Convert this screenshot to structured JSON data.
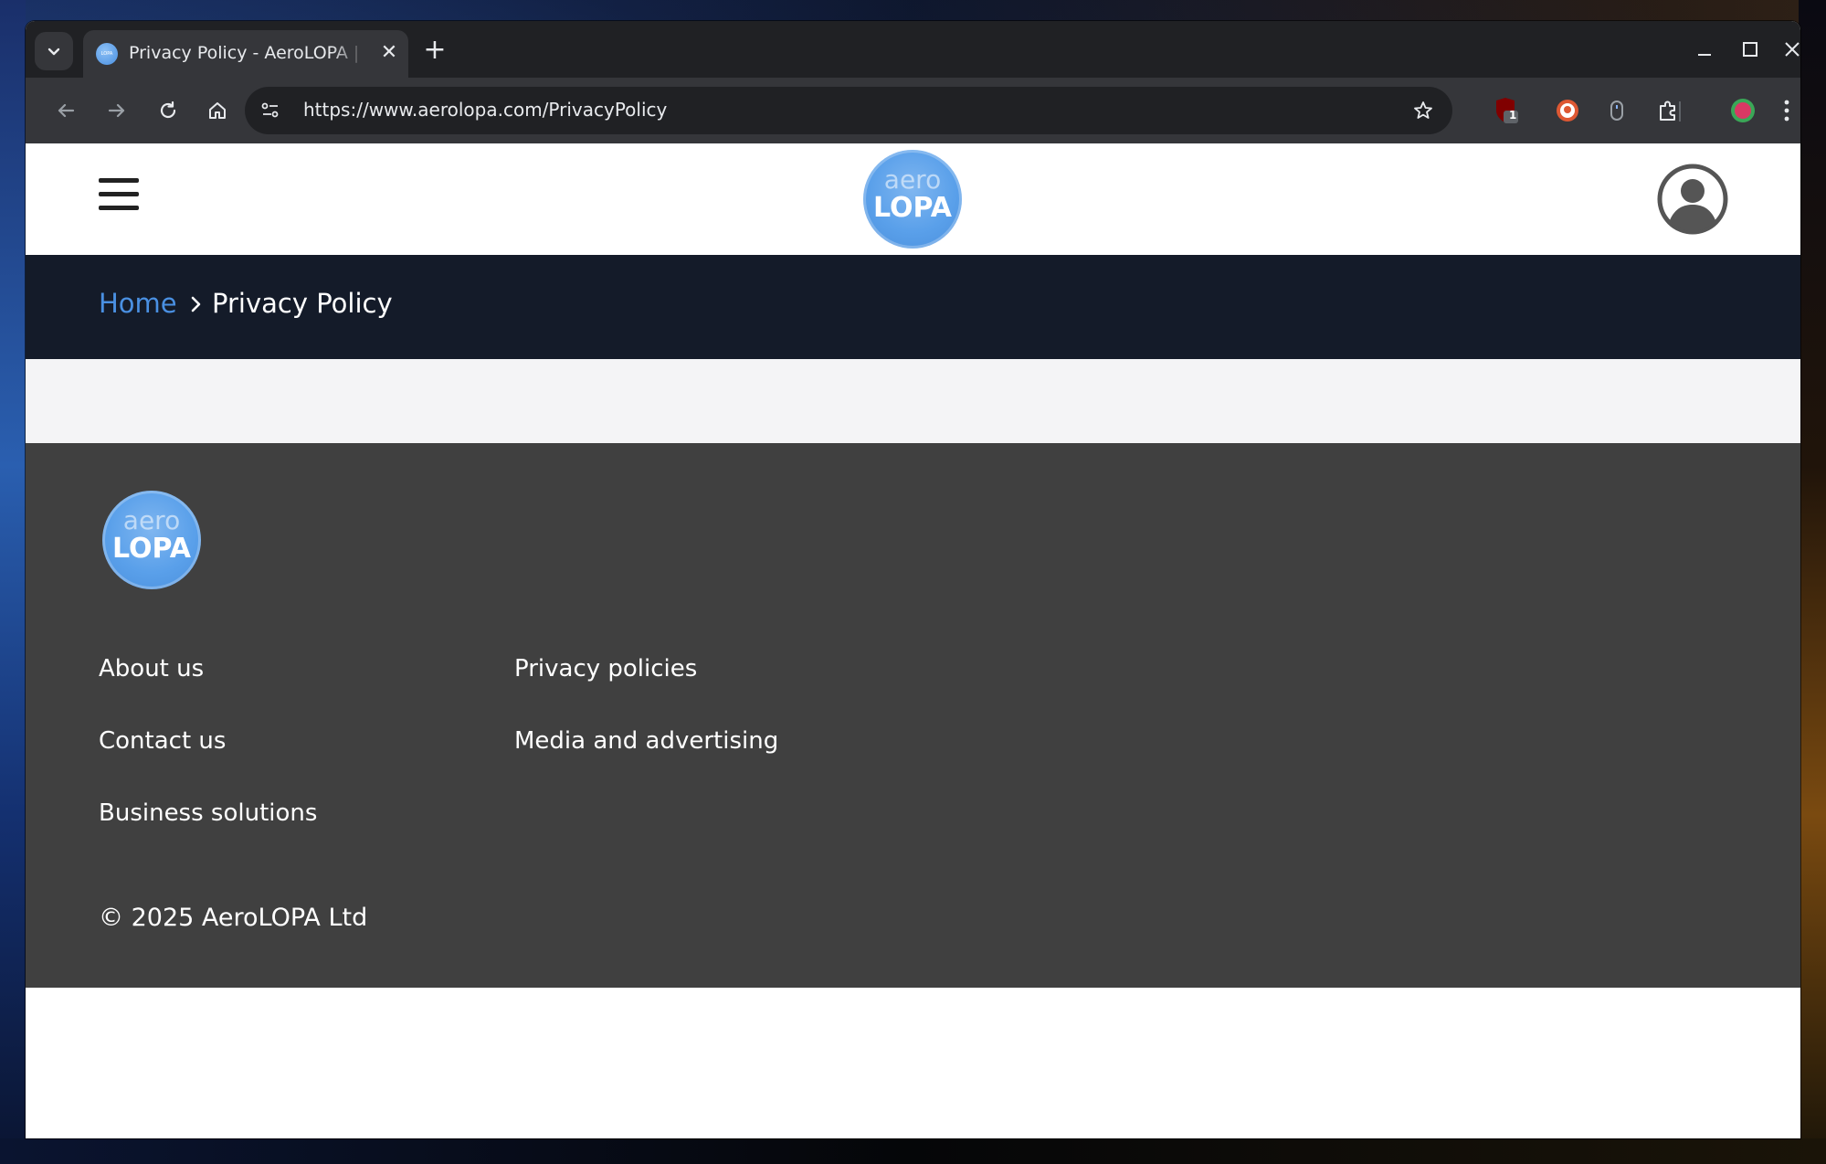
{
  "browser": {
    "tab_title": "Privacy Policy - AeroLOPA | D",
    "favicon_text": "LOPA",
    "url": "https://www.aerolopa.com/PrivacyPolicy",
    "extension_badge": "1"
  },
  "site": {
    "logo_top": "aero",
    "logo_bottom": "LOPA"
  },
  "breadcrumb": {
    "home": "Home",
    "current": "Privacy Policy"
  },
  "footer": {
    "links_col1": [
      "About us",
      "Contact us",
      "Business solutions"
    ],
    "links_col2": [
      "Privacy policies",
      "Media and advertising"
    ],
    "copyright": "© 2025 AeroLOPA Ltd"
  },
  "colors": {
    "accent": "#4a90e2",
    "breadcrumb_bg": "#141b29",
    "footer_bg": "#404040"
  }
}
